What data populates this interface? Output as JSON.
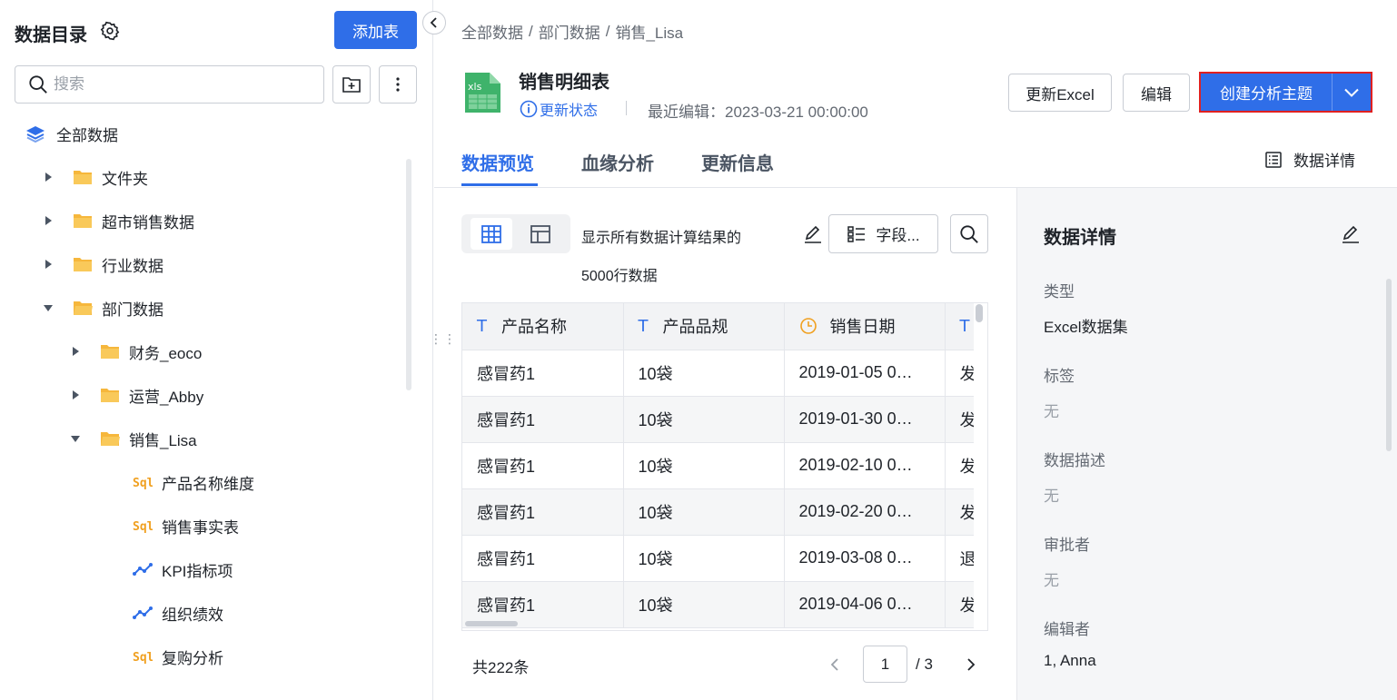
{
  "sidebar": {
    "title": "数据目录",
    "add_table_label": "添加表",
    "search_placeholder": "搜索",
    "tree": [
      {
        "label": "全部数据",
        "type": "root"
      },
      {
        "label": "文件夹",
        "type": "folder"
      },
      {
        "label": "超市销售数据",
        "type": "folder"
      },
      {
        "label": "行业数据",
        "type": "folder"
      },
      {
        "label": "部门数据",
        "type": "folder"
      },
      {
        "label": "财务_eoco",
        "type": "folder"
      },
      {
        "label": "运营_Abby",
        "type": "folder"
      },
      {
        "label": "销售_Lisa",
        "type": "folder"
      },
      {
        "label": "产品名称维度",
        "type": "sql"
      },
      {
        "label": "销售事实表",
        "type": "sql"
      },
      {
        "label": "KPI指标项",
        "type": "metric"
      },
      {
        "label": "组织绩效",
        "type": "metric"
      },
      {
        "label": "复购分析",
        "type": "sql"
      }
    ]
  },
  "breadcrumb": [
    "全部数据",
    "部门数据",
    "销售_Lisa"
  ],
  "header": {
    "file_title": "销售明细表",
    "update_status": "更新状态",
    "last_edit": "最近编辑：2023-03-21 00:00:00",
    "buttons": {
      "update_excel": "更新Excel",
      "edit": "编辑",
      "create_topic": "创建分析主题"
    }
  },
  "tabs": [
    "数据预览",
    "血缘分析",
    "更新信息"
  ],
  "data_detail_link": "数据详情",
  "preview": {
    "show_text": "显示所有数据计算结果的",
    "row_count": "5000行数据",
    "fields_label": "字段...",
    "columns": [
      {
        "name": "产品名称",
        "icon": "text-type-icon"
      },
      {
        "name": "产品品规",
        "icon": "text-type-icon"
      },
      {
        "name": "销售日期",
        "icon": "clock-type-icon"
      },
      {
        "name": "",
        "icon": "text-type-icon"
      }
    ],
    "rows": [
      [
        "感冒药1",
        "10袋",
        "2019-01-05 0…",
        "发"
      ],
      [
        "感冒药1",
        "10袋",
        "2019-01-30 0…",
        "发"
      ],
      [
        "感冒药1",
        "10袋",
        "2019-02-10 0…",
        "发"
      ],
      [
        "感冒药1",
        "10袋",
        "2019-02-20 0…",
        "发"
      ],
      [
        "感冒药1",
        "10袋",
        "2019-03-08 0…",
        "退"
      ],
      [
        "感冒药1",
        "10袋",
        "2019-04-06 0…",
        "发"
      ]
    ],
    "total": "共222条",
    "page": "1",
    "page_total": "/ 3"
  },
  "detail": {
    "title": "数据详情",
    "fields": [
      {
        "label": "类型",
        "value": "Excel数据集"
      },
      {
        "label": "标签",
        "value": "无"
      },
      {
        "label": "数据描述",
        "value": "无"
      },
      {
        "label": "审批者",
        "value": "无"
      },
      {
        "label": "编辑者",
        "value": "1, Anna"
      }
    ]
  },
  "colors": {
    "primary": "#2f6ee8",
    "folder": "#f6b73c",
    "sql": "#f0a020",
    "highlight_border": "#e02020"
  }
}
